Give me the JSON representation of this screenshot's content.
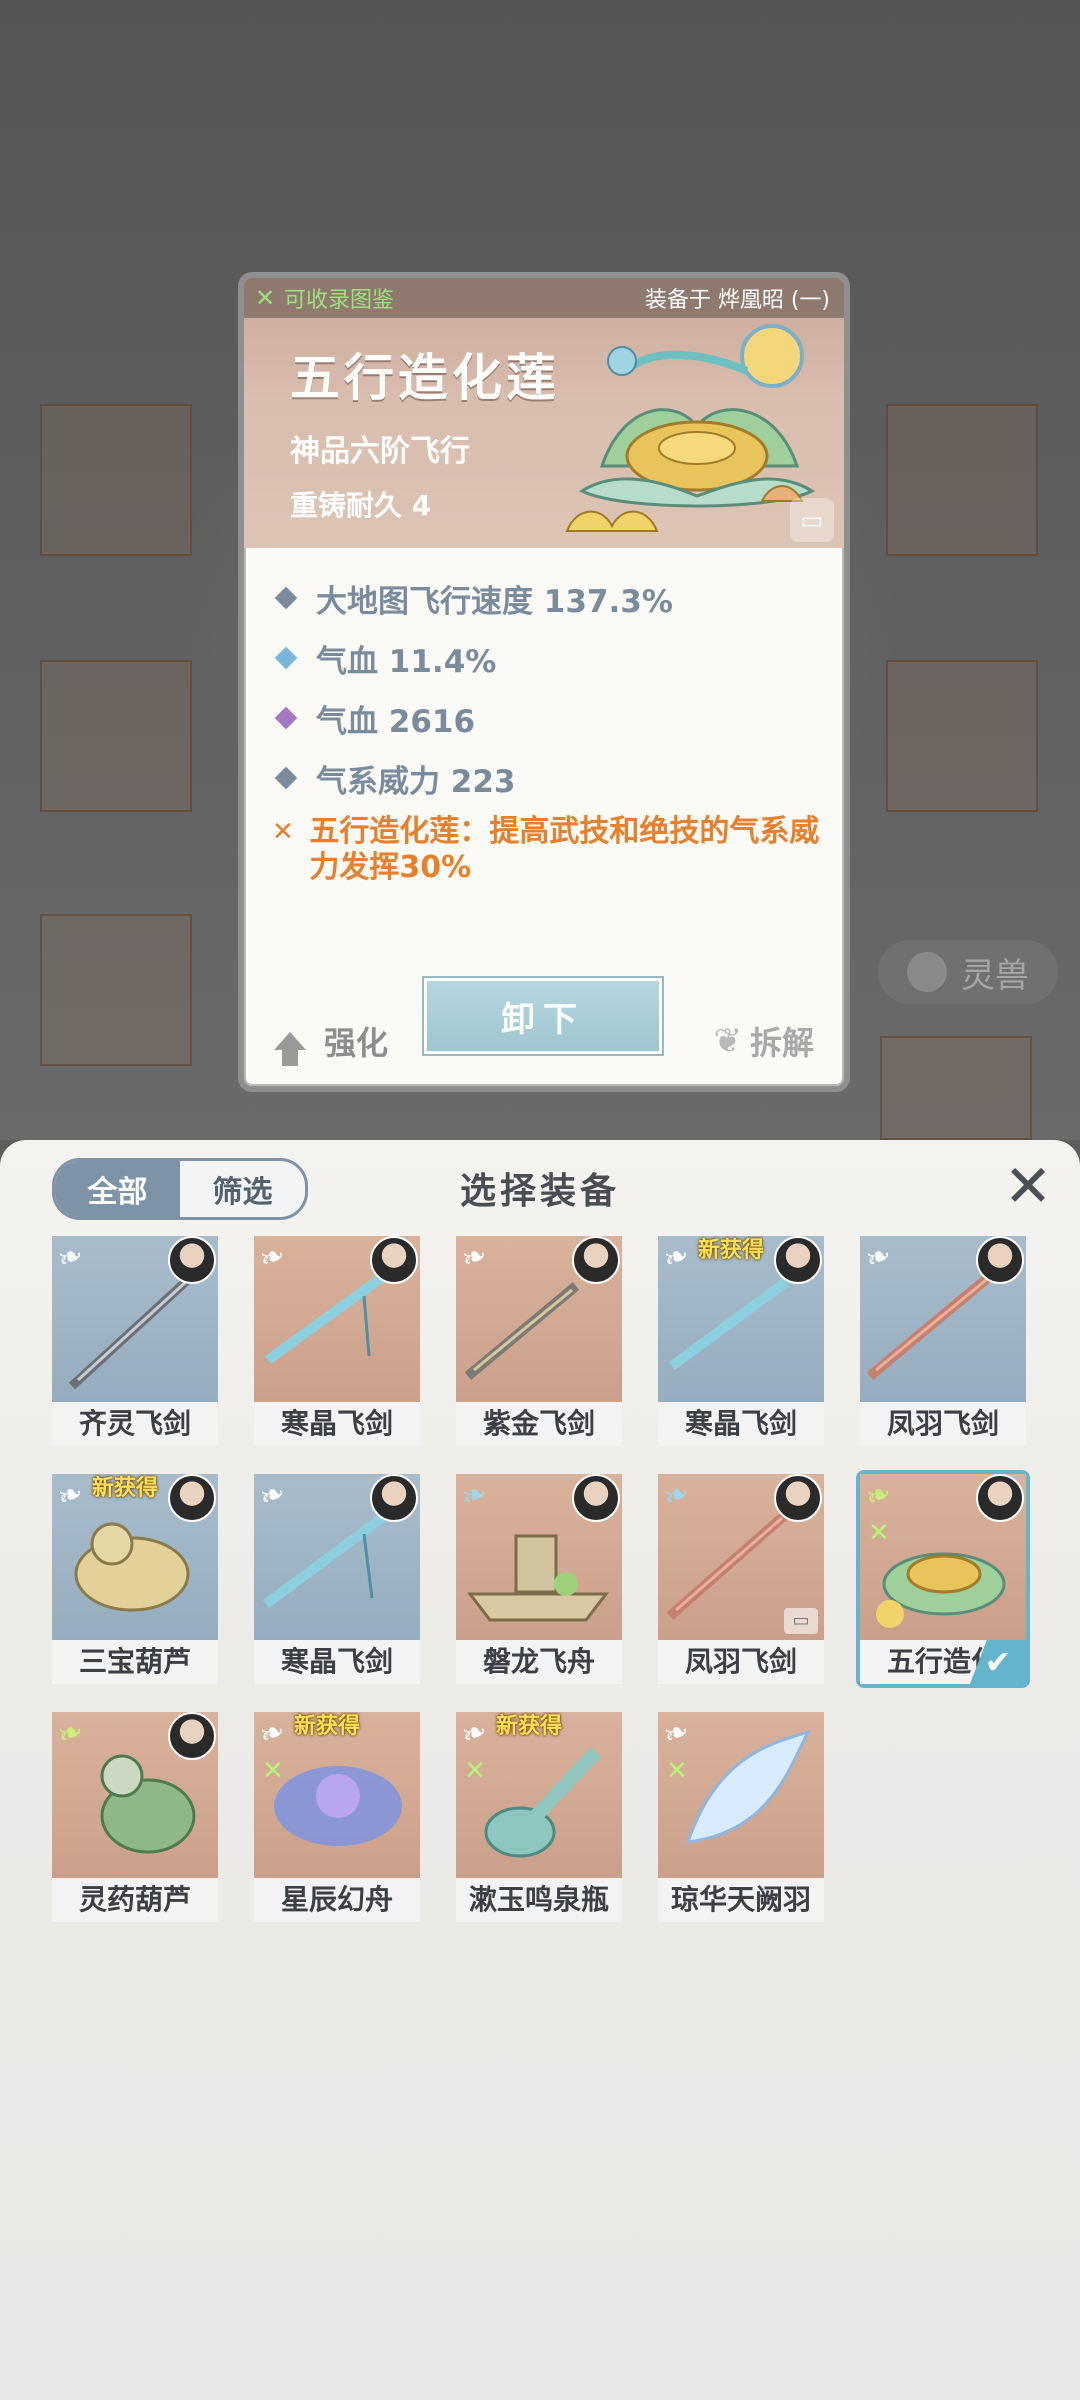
{
  "popup": {
    "collect_label": "可收录图鉴",
    "equipped_on": "装备于 烨凰昭 (一)",
    "title": "五行造化莲",
    "grade": "神品六阶飞行",
    "durability": "重铸耐久 4",
    "stats": [
      {
        "text": "大地图飞行速度 137.3%",
        "color": "#7a8b9c"
      },
      {
        "text": "气血 11.4%",
        "color": "#7ab8da"
      },
      {
        "text": "气血 2616",
        "color": "#a678c4"
      },
      {
        "text": "气系威力 223",
        "color": "#7a8b9c"
      }
    ],
    "effect": "五行造化莲：提高武技和绝技的气系威力发挥30%",
    "strengthen_label": "强化",
    "unequip_label": "卸下",
    "dismantle_label": "拆解"
  },
  "background": {
    "beast_label": "灵兽"
  },
  "panel": {
    "tab_all": "全部",
    "tab_filter": "筛选",
    "title": "选择装备",
    "new_label": "新获得",
    "items": [
      {
        "name": "齐灵飞剑"
      },
      {
        "name": "寒晶飞剑"
      },
      {
        "name": "紫金飞剑"
      },
      {
        "name": "寒晶飞剑"
      },
      {
        "name": "凤羽飞剑"
      },
      {
        "name": "三宝葫芦"
      },
      {
        "name": "寒晶飞剑"
      },
      {
        "name": "磐龙飞舟"
      },
      {
        "name": "凤羽飞剑"
      },
      {
        "name": "五行造化"
      },
      {
        "name": "灵药葫芦"
      },
      {
        "name": "星辰幻舟"
      },
      {
        "name": "漱玉鸣泉瓶"
      },
      {
        "name": "琼华天阙羽"
      }
    ]
  }
}
